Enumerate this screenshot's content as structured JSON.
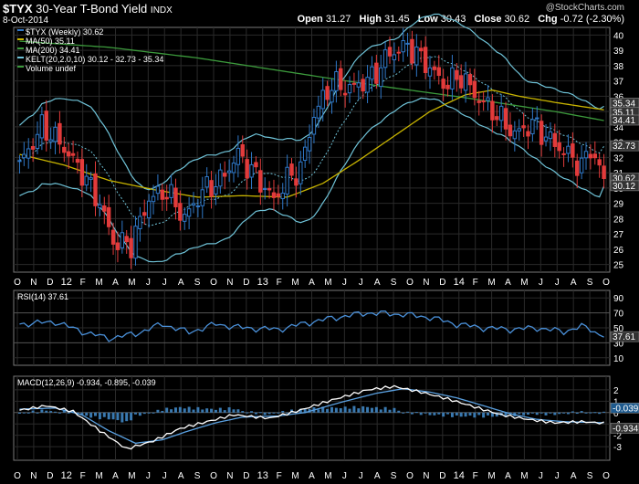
{
  "header": {
    "symbol": "$TYX",
    "name": "30-Year T-Bond Yield",
    "exchange": "INDX",
    "date": "8-Oct-2014",
    "watermark": "@StockCharts.com",
    "open_label": "Open",
    "open": "31.27",
    "high_label": "High",
    "high": "31.45",
    "low_label": "Low",
    "low": "30.43",
    "close_label": "Close",
    "close": "30.62",
    "chg_label": "Chg",
    "chg": "-0.72 (-2.30%)"
  },
  "colors": {
    "up": "#2f78c8",
    "down": "#e23b3b",
    "ma50": "#c8b400",
    "ma200": "#3c9a3c",
    "kelt": "#6fc3d8",
    "rsi": "#4a90d9",
    "macd": "#ffffff",
    "signal": "#5aa0e0",
    "hist": "#3a79b0",
    "grid": "#2a2a2a"
  },
  "chart_data": [
    {
      "type": "candlestick",
      "title": "$TYX (Weekly) 30.62",
      "legend": [
        {
          "label": "$TYX (Weekly) 30.62",
          "color": "#2f78c8"
        },
        {
          "label": "MA(50) 35.11",
          "color": "#c8b400"
        },
        {
          "label": "MA(200) 34.41",
          "color": "#3c9a3c"
        },
        {
          "label": "KELT(20,2.0,10) 30.12 - 32.73 - 35.34",
          "color": "#6fc3d8"
        },
        {
          "label": "Volume undef",
          "color": "#3c9a3c"
        }
      ],
      "ylim": [
        24.5,
        40.5
      ],
      "yticks": [
        25,
        26,
        27,
        28,
        29,
        30,
        31,
        32,
        33,
        34,
        35,
        36,
        37,
        38,
        39,
        40
      ],
      "x_labels": [
        "O",
        "N",
        "D",
        "12",
        "F",
        "M",
        "A",
        "M",
        "J",
        "J",
        "A",
        "S",
        "O",
        "N",
        "D",
        "13",
        "F",
        "M",
        "A",
        "M",
        "J",
        "J",
        "A",
        "S",
        "O",
        "N",
        "D",
        "14",
        "F",
        "M",
        "A",
        "M",
        "J",
        "J",
        "A",
        "S",
        "O"
      ],
      "price_anchors": [
        [
          0,
          31.5
        ],
        [
          5,
          34
        ],
        [
          9,
          33
        ],
        [
          14,
          31
        ],
        [
          18,
          29
        ],
        [
          21,
          26.5
        ],
        [
          25,
          26.3
        ],
        [
          29,
          29.3
        ],
        [
          33,
          29.8
        ],
        [
          37,
          28
        ],
        [
          41,
          29.8
        ],
        [
          45,
          30.5
        ],
        [
          49,
          32.2
        ],
        [
          53,
          30.8
        ],
        [
          57,
          29.2
        ],
        [
          60,
          30.6
        ],
        [
          63,
          31.2
        ],
        [
          66,
          34.8
        ],
        [
          70,
          36.8
        ],
        [
          74,
          36.5
        ],
        [
          79,
          37.2
        ],
        [
          83,
          38.8
        ],
        [
          87,
          39.3
        ],
        [
          91,
          38.2
        ],
        [
          95,
          36.8
        ],
        [
          99,
          37.3
        ],
        [
          103,
          35.8
        ],
        [
          107,
          34.8
        ],
        [
          111,
          33.5
        ],
        [
          115,
          34.2
        ],
        [
          119,
          33.1
        ],
        [
          123,
          32.2
        ],
        [
          126,
          31.4
        ],
        [
          128,
          32.6
        ],
        [
          130,
          31.3
        ],
        [
          131,
          30.62
        ]
      ],
      "ma50_anchors": [
        [
          0,
          32.2
        ],
        [
          10,
          31.5
        ],
        [
          20,
          30.5
        ],
        [
          30,
          29.9
        ],
        [
          40,
          29.4
        ],
        [
          50,
          29.5
        ],
        [
          60,
          29.4
        ],
        [
          68,
          30.3
        ],
        [
          76,
          31.8
        ],
        [
          84,
          33.4
        ],
        [
          92,
          35.0
        ],
        [
          100,
          36.1
        ],
        [
          106,
          36.4
        ],
        [
          112,
          36.0
        ],
        [
          120,
          35.6
        ],
        [
          131,
          35.11
        ]
      ],
      "ma200_anchors": [
        [
          0,
          39.6
        ],
        [
          20,
          39.2
        ],
        [
          40,
          38.5
        ],
        [
          60,
          37.6
        ],
        [
          80,
          36.7
        ],
        [
          100,
          35.9
        ],
        [
          120,
          35.0
        ],
        [
          131,
          34.41
        ]
      ],
      "kelt_last": {
        "lower": 30.12,
        "middle": 32.73,
        "upper": 35.34
      },
      "last_labels": [
        {
          "value": 35.34,
          "text": "35.34",
          "color": "#ffffff"
        },
        {
          "value": 35.11,
          "text": "35.11",
          "color": "#ffffff"
        },
        {
          "value": 34.41,
          "text": "34.41",
          "color": "#ffffff"
        },
        {
          "value": 32.73,
          "text": "32.73",
          "color": "#ffffff"
        },
        {
          "value": 30.62,
          "text": "30.62",
          "color": "#ffffff"
        },
        {
          "value": 30.12,
          "text": "30.12",
          "color": "#ffffff"
        }
      ]
    },
    {
      "type": "line",
      "title": "RSI(14) 37.61",
      "ylim": [
        0,
        100
      ],
      "yticks": [
        10,
        30,
        50,
        70,
        90
      ],
      "last": 37.61,
      "anchors": [
        [
          0,
          55
        ],
        [
          8,
          58
        ],
        [
          14,
          45
        ],
        [
          20,
          36
        ],
        [
          26,
          42
        ],
        [
          32,
          55
        ],
        [
          38,
          44
        ],
        [
          44,
          55
        ],
        [
          50,
          50
        ],
        [
          58,
          48
        ],
        [
          64,
          56
        ],
        [
          70,
          63
        ],
        [
          78,
          70
        ],
        [
          86,
          68
        ],
        [
          92,
          64
        ],
        [
          98,
          55
        ],
        [
          104,
          50
        ],
        [
          110,
          48
        ],
        [
          116,
          50
        ],
        [
          122,
          45
        ],
        [
          126,
          52
        ],
        [
          128,
          48
        ],
        [
          131,
          37.61
        ]
      ]
    },
    {
      "type": "line",
      "title": "MACD(12,26,9) -0.934, -0.895, -0.039",
      "ylim": [
        -4.2,
        3.2
      ],
      "yticks": [
        -3,
        -2,
        -1,
        0,
        1,
        2
      ],
      "macd_last": -0.934,
      "signal_last": -0.895,
      "hist_last": -0.039,
      "macd_anchors": [
        [
          0,
          0.2
        ],
        [
          6,
          0.6
        ],
        [
          12,
          0.1
        ],
        [
          18,
          -1.6
        ],
        [
          24,
          -3.2
        ],
        [
          30,
          -2.5
        ],
        [
          36,
          -1.4
        ],
        [
          42,
          -0.8
        ],
        [
          48,
          -0.2
        ],
        [
          56,
          -0.5
        ],
        [
          62,
          0.1
        ],
        [
          70,
          1.1
        ],
        [
          78,
          2.0
        ],
        [
          84,
          2.3
        ],
        [
          90,
          1.8
        ],
        [
          96,
          1.2
        ],
        [
          102,
          0.5
        ],
        [
          108,
          -0.2
        ],
        [
          114,
          -0.6
        ],
        [
          120,
          -0.9
        ],
        [
          126,
          -0.8
        ],
        [
          131,
          -0.934
        ]
      ],
      "signal_anchors": [
        [
          0,
          0.3
        ],
        [
          8,
          0.4
        ],
        [
          14,
          -0.2
        ],
        [
          20,
          -1.6
        ],
        [
          26,
          -2.7
        ],
        [
          32,
          -2.4
        ],
        [
          38,
          -1.6
        ],
        [
          44,
          -0.9
        ],
        [
          50,
          -0.4
        ],
        [
          58,
          -0.3
        ],
        [
          64,
          0.0
        ],
        [
          72,
          0.9
        ],
        [
          80,
          1.7
        ],
        [
          86,
          2.1
        ],
        [
          92,
          1.8
        ],
        [
          98,
          1.3
        ],
        [
          104,
          0.6
        ],
        [
          110,
          -0.1
        ],
        [
          116,
          -0.6
        ],
        [
          122,
          -0.8
        ],
        [
          131,
          -0.895
        ]
      ]
    }
  ]
}
